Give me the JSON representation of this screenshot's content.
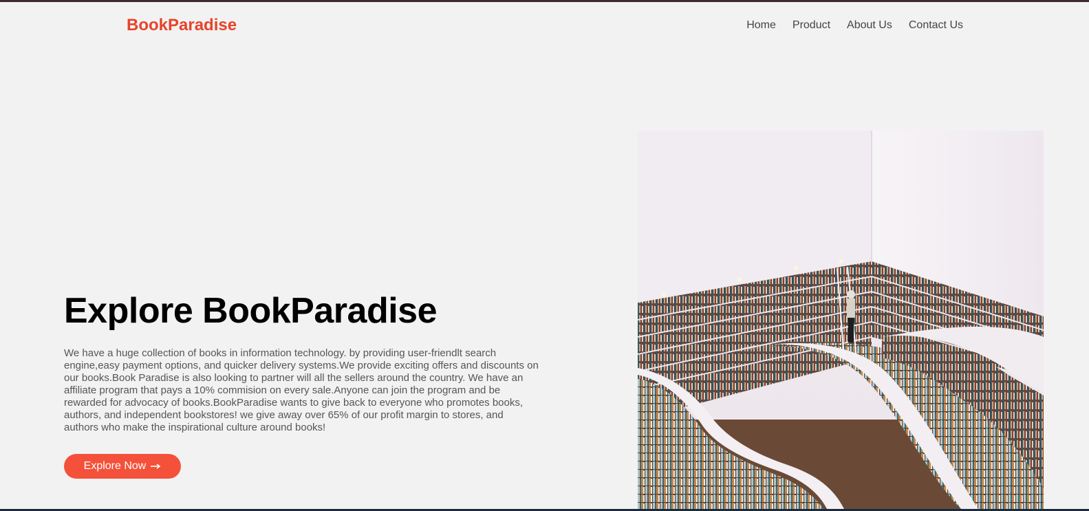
{
  "brand": {
    "name": "BookParadise",
    "color": "#e8432a"
  },
  "nav": {
    "items": [
      {
        "label": "Home"
      },
      {
        "label": "Product"
      },
      {
        "label": "About Us"
      },
      {
        "label": "Contact Us"
      }
    ]
  },
  "hero": {
    "title": "Explore BookParadise",
    "description": "We have a huge collection of books in information technology. by providing user-friendlt search engine,easy payment options, and quicker delivery systems.We provide exciting offers and discounts on our books.Book Paradise is also looking to partner will all the sellers around the country. We have an affiliate program that pays a 10% commision on every sale.Anyone can join the program and be rewarded for advocacy of books.BookParadise wants to give back to everyone who promotes books, authors, and independent bookstores! we give away over 65% of our profit margin to stores, and authors who make the inspirational culture around books!",
    "button_label": "Explore Now",
    "button_icon": "arrow-right-icon",
    "button_color": "#f4513a"
  },
  "image": {
    "semantic": "library-bookshelves-photo"
  }
}
